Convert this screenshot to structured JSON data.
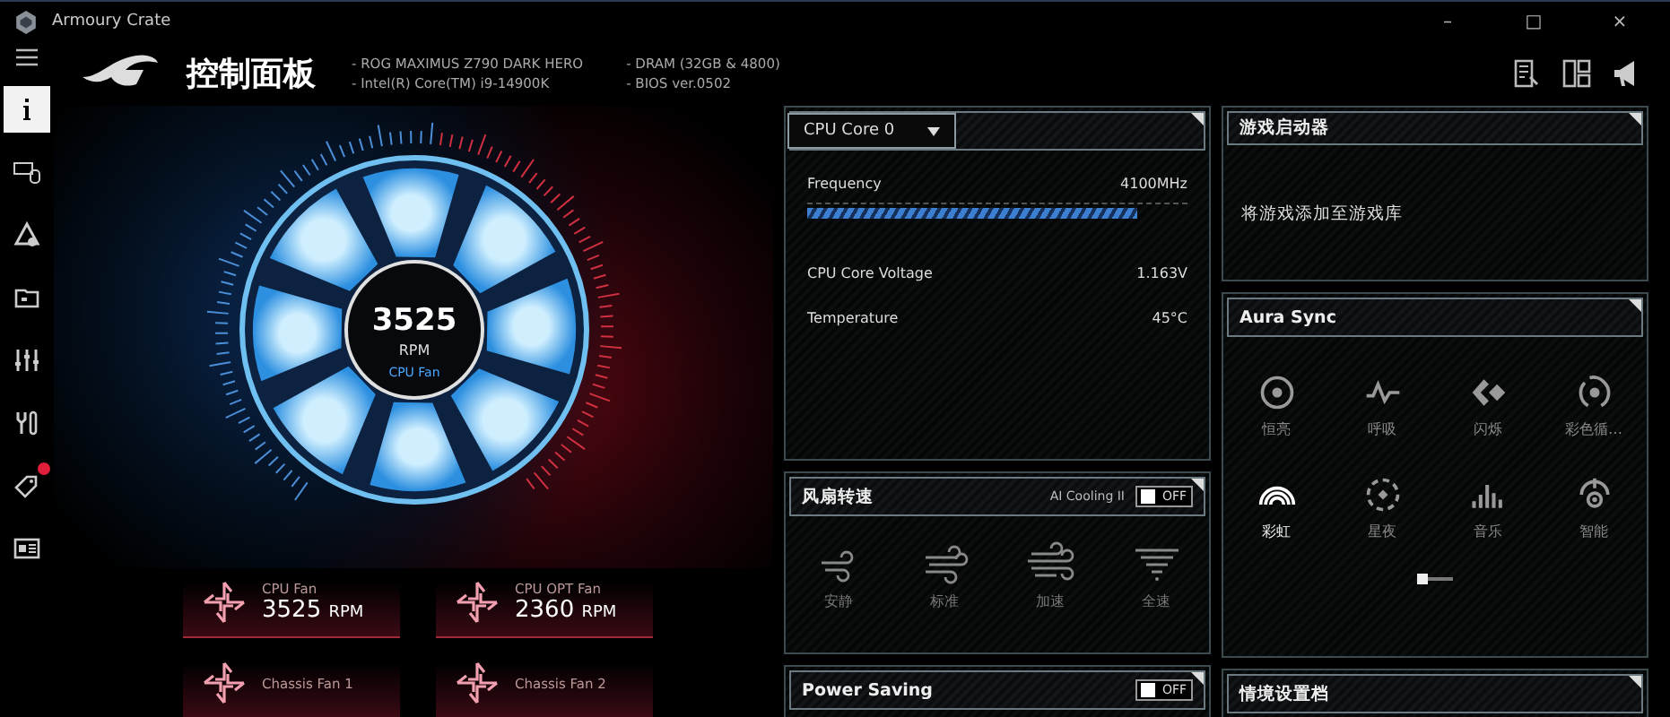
{
  "window": {
    "title": "Armoury Crate",
    "controls": [
      "–",
      "□",
      "×"
    ]
  },
  "header": {
    "title": "控制面板",
    "specs": [
      "- ROG MAXIMUS Z790 DARK HERO",
      "- Intel(R) Core(TM) i9-14900K",
      "- DRAM (32GB & 4800)",
      "- BIOS ver.0502"
    ]
  },
  "sidebar": {
    "items": [
      {
        "selected": true,
        "badge": false
      },
      {
        "selected": false,
        "badge": false
      },
      {
        "selected": false,
        "badge": false
      },
      {
        "selected": false,
        "badge": false
      },
      {
        "selected": false,
        "badge": false
      },
      {
        "selected": false,
        "badge": false
      },
      {
        "selected": false,
        "badge": true
      },
      {
        "selected": false,
        "badge": false
      }
    ]
  },
  "gauge": {
    "value": "3525",
    "unit": "RPM",
    "label": "CPU Fan"
  },
  "fans": [
    {
      "name": "CPU Fan",
      "value": "3525",
      "unit": "RPM"
    },
    {
      "name": "CPU OPT Fan",
      "value": "2360",
      "unit": "RPM"
    },
    {
      "name": "Chassis Fan 1"
    },
    {
      "name": "Chassis Fan 2"
    }
  ],
  "cpu_panel": {
    "selector": "CPU Core 0",
    "frequency": {
      "label": "Frequency",
      "reading": "4100MHz",
      "level": 0.87
    },
    "rows": [
      {
        "label": "CPU Core Voltage",
        "value": "1.163V"
      },
      {
        "label": "Temperature",
        "value": "45°C"
      }
    ]
  },
  "fan_speed": {
    "title": "风扇转速",
    "ai_cooling": {
      "label": "AI Cooling II",
      "on": false,
      "state_text": "OFF"
    },
    "modes": [
      {
        "label": "安静"
      },
      {
        "label": "标准"
      },
      {
        "label": "加速"
      },
      {
        "label": "全速"
      }
    ]
  },
  "power_saving": {
    "title": "Power Saving",
    "on": false,
    "state_text": "OFF"
  },
  "game_launcher": {
    "title": "游戏启动器",
    "message": "将游戏添加至游戏库"
  },
  "aura_sync": {
    "title": "Aura Sync",
    "effects": [
      {
        "label": "恒亮",
        "selected": false
      },
      {
        "label": "呼吸",
        "selected": false
      },
      {
        "label": "闪烁",
        "selected": false
      },
      {
        "label": "彩色循…",
        "selected": false
      },
      {
        "label": "彩虹",
        "selected": true
      },
      {
        "label": "星夜",
        "selected": false
      },
      {
        "label": "音乐",
        "selected": false
      },
      {
        "label": "智能",
        "selected": false
      }
    ],
    "pages": [
      {
        "selected": true
      },
      {
        "selected": false
      }
    ]
  },
  "scenario_profiles": {
    "title": "情境设置档"
  }
}
